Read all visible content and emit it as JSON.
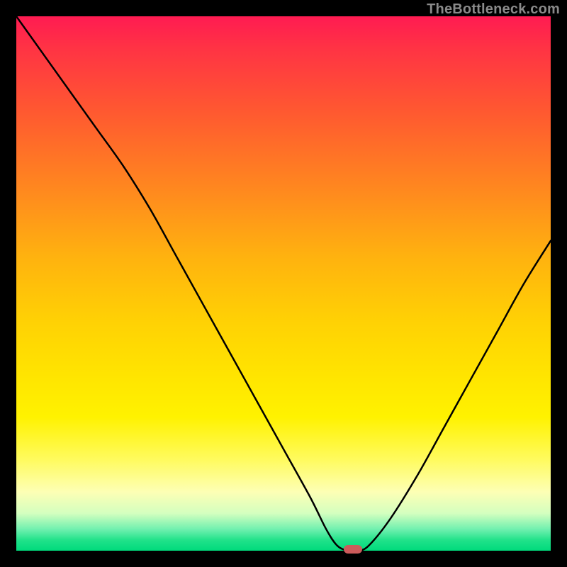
{
  "watermark": "TheBottleneck.com",
  "colors": {
    "frame": "#000000",
    "curve": "#000000",
    "marker": "#cc5b5b"
  },
  "chart_data": {
    "type": "line",
    "title": "",
    "xlabel": "",
    "ylabel": "",
    "xlim": [
      0,
      100
    ],
    "ylim": [
      0,
      100
    ],
    "grid": false,
    "legend": false,
    "x": [
      0,
      5,
      10,
      15,
      20,
      25,
      30,
      35,
      40,
      45,
      50,
      55,
      58,
      60,
      62,
      64,
      66,
      70,
      75,
      80,
      85,
      90,
      95,
      100
    ],
    "y": [
      100,
      93,
      86,
      79,
      72,
      64,
      55,
      46,
      37,
      28,
      19,
      10,
      4,
      1,
      0,
      0,
      1,
      6,
      14,
      23,
      32,
      41,
      50,
      58
    ],
    "marker": {
      "x": 63,
      "y": 0
    },
    "notes": "Values estimated from pixel positions; curve is a V-shaped bottleneck plot with minimum near x≈63."
  }
}
